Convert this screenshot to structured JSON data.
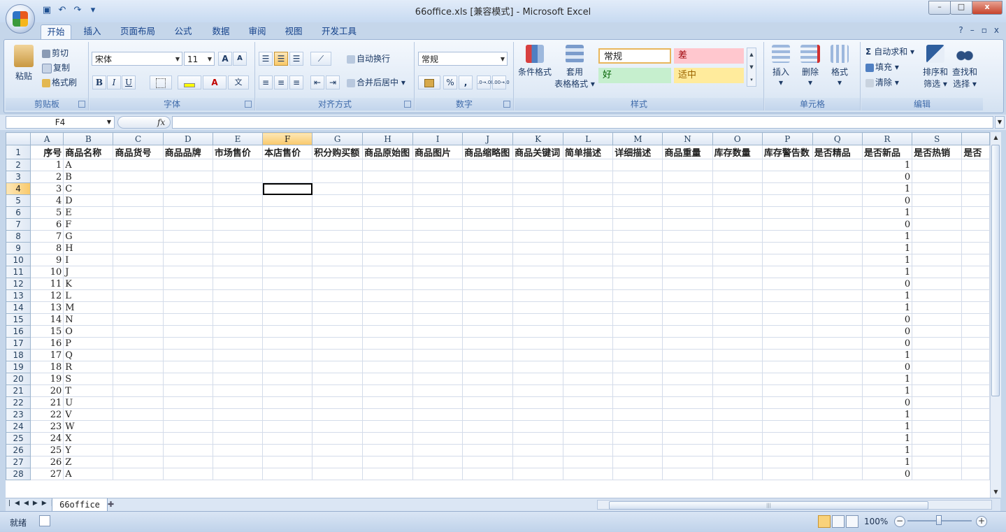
{
  "window": {
    "title": "66office.xls  [兼容模式] - Microsoft Excel",
    "minimize": "–",
    "restore": "□",
    "close": "x"
  },
  "qat": {
    "save_icon": "save-icon",
    "undo_icon": "undo-icon",
    "redo_icon": "redo-icon"
  },
  "tabs": [
    "开始",
    "插入",
    "页面布局",
    "公式",
    "数据",
    "审阅",
    "视图",
    "开发工具"
  ],
  "tab_right": {
    "help": "?",
    "min": "–",
    "restore": "▫",
    "close": "x"
  },
  "ribbon": {
    "clipboard": {
      "label": "剪贴板",
      "paste": "粘贴",
      "cut": "剪切",
      "copy": "复制",
      "format_painter": "格式刷"
    },
    "font": {
      "label": "字体",
      "font_name": "宋体",
      "font_size": "11",
      "grow": "A",
      "shrink": "A",
      "bold": "B",
      "italic": "I",
      "underline": "U",
      "font_color_glyph": "A",
      "wen": "wén",
      "phonetic": "文"
    },
    "alignment": {
      "label": "对齐方式",
      "wrap_text": "自动换行",
      "merge_center": "合并后居中"
    },
    "number": {
      "label": "数字",
      "format": "常规",
      "percent": "%",
      "comma": ",",
      "inc_decimal": ".0→.00",
      "dec_decimal": ".00→.0"
    },
    "styles": {
      "label": "样式",
      "conditional": "条件格式",
      "table_format_1": "套用",
      "table_format_2": "表格格式",
      "normal": "常规",
      "bad": "差",
      "good": "好",
      "neutral": "适中"
    },
    "cells": {
      "label": "单元格",
      "insert": "插入",
      "delete": "删除",
      "format": "格式"
    },
    "editing": {
      "label": "编辑",
      "sigma": "Σ",
      "autosum": "自动求和",
      "fill": "填充",
      "clear": "清除",
      "sort_1": "排序和",
      "sort_2": "筛选",
      "find_1": "查找和",
      "find_2": "选择"
    }
  },
  "formula_bar": {
    "name_box": "F4",
    "fx": "fx",
    "content": ""
  },
  "columns": [
    "A",
    "B",
    "C",
    "D",
    "E",
    "F",
    "G",
    "H",
    "I",
    "J",
    "K",
    "L",
    "M",
    "N",
    "O",
    "P",
    "Q",
    "R",
    "S"
  ],
  "header_row": [
    "序号",
    "商品名称",
    "商品货号",
    "商品品牌",
    "市场售价",
    "本店售价",
    "积分购买额",
    "商品原始图",
    "商品图片",
    "商品缩略图",
    "商品关键词",
    "简单描述",
    "详细描述",
    "商品重量",
    "库存数量",
    "库存警告数",
    "是否精品",
    "是否新品",
    "是否热销",
    "是否"
  ],
  "rows": [
    {
      "r": "2",
      "a": "1",
      "b": "A",
      "q": "1"
    },
    {
      "r": "3",
      "a": "2",
      "b": "B",
      "q": "0"
    },
    {
      "r": "4",
      "a": "3",
      "b": "C",
      "q": "1"
    },
    {
      "r": "5",
      "a": "4",
      "b": "D",
      "q": "0"
    },
    {
      "r": "6",
      "a": "5",
      "b": "E",
      "q": "1"
    },
    {
      "r": "7",
      "a": "6",
      "b": "F",
      "q": "0"
    },
    {
      "r": "8",
      "a": "7",
      "b": "G",
      "q": "1"
    },
    {
      "r": "9",
      "a": "8",
      "b": "H",
      "q": "1"
    },
    {
      "r": "10",
      "a": "9",
      "b": "I",
      "q": "1"
    },
    {
      "r": "11",
      "a": "10",
      "b": "J",
      "q": "1"
    },
    {
      "r": "12",
      "a": "11",
      "b": "K",
      "q": "0"
    },
    {
      "r": "13",
      "a": "12",
      "b": "L",
      "q": "1"
    },
    {
      "r": "14",
      "a": "13",
      "b": "M",
      "q": "1"
    },
    {
      "r": "15",
      "a": "14",
      "b": "N",
      "q": "0"
    },
    {
      "r": "16",
      "a": "15",
      "b": "O",
      "q": "0"
    },
    {
      "r": "17",
      "a": "16",
      "b": "P",
      "q": "0"
    },
    {
      "r": "18",
      "a": "17",
      "b": "Q",
      "q": "1"
    },
    {
      "r": "19",
      "a": "18",
      "b": "R",
      "q": "0"
    },
    {
      "r": "20",
      "a": "19",
      "b": "S",
      "q": "1"
    },
    {
      "r": "21",
      "a": "20",
      "b": "T",
      "q": "1"
    },
    {
      "r": "22",
      "a": "21",
      "b": "U",
      "q": "0"
    },
    {
      "r": "23",
      "a": "22",
      "b": "V",
      "q": "1"
    },
    {
      "r": "24",
      "a": "23",
      "b": "W",
      "q": "1"
    },
    {
      "r": "25",
      "a": "24",
      "b": "X",
      "q": "1"
    },
    {
      "r": "26",
      "a": "25",
      "b": "Y",
      "q": "1"
    },
    {
      "r": "27",
      "a": "26",
      "b": "Z",
      "q": "1"
    },
    {
      "r": "28",
      "a": "27",
      "b": "A",
      "q": "0"
    }
  ],
  "selection": {
    "cell": "F4",
    "col": "F",
    "row": "4"
  },
  "sheet_tabs": [
    "66office"
  ],
  "status": {
    "ready": "就绪",
    "zoom": "100%",
    "zoom_minus": "−",
    "zoom_plus": "+"
  },
  "colors": {
    "accent": "#15428b",
    "selected_header": "#f9c96a",
    "ribbon_bg": "#dfe9f5"
  }
}
